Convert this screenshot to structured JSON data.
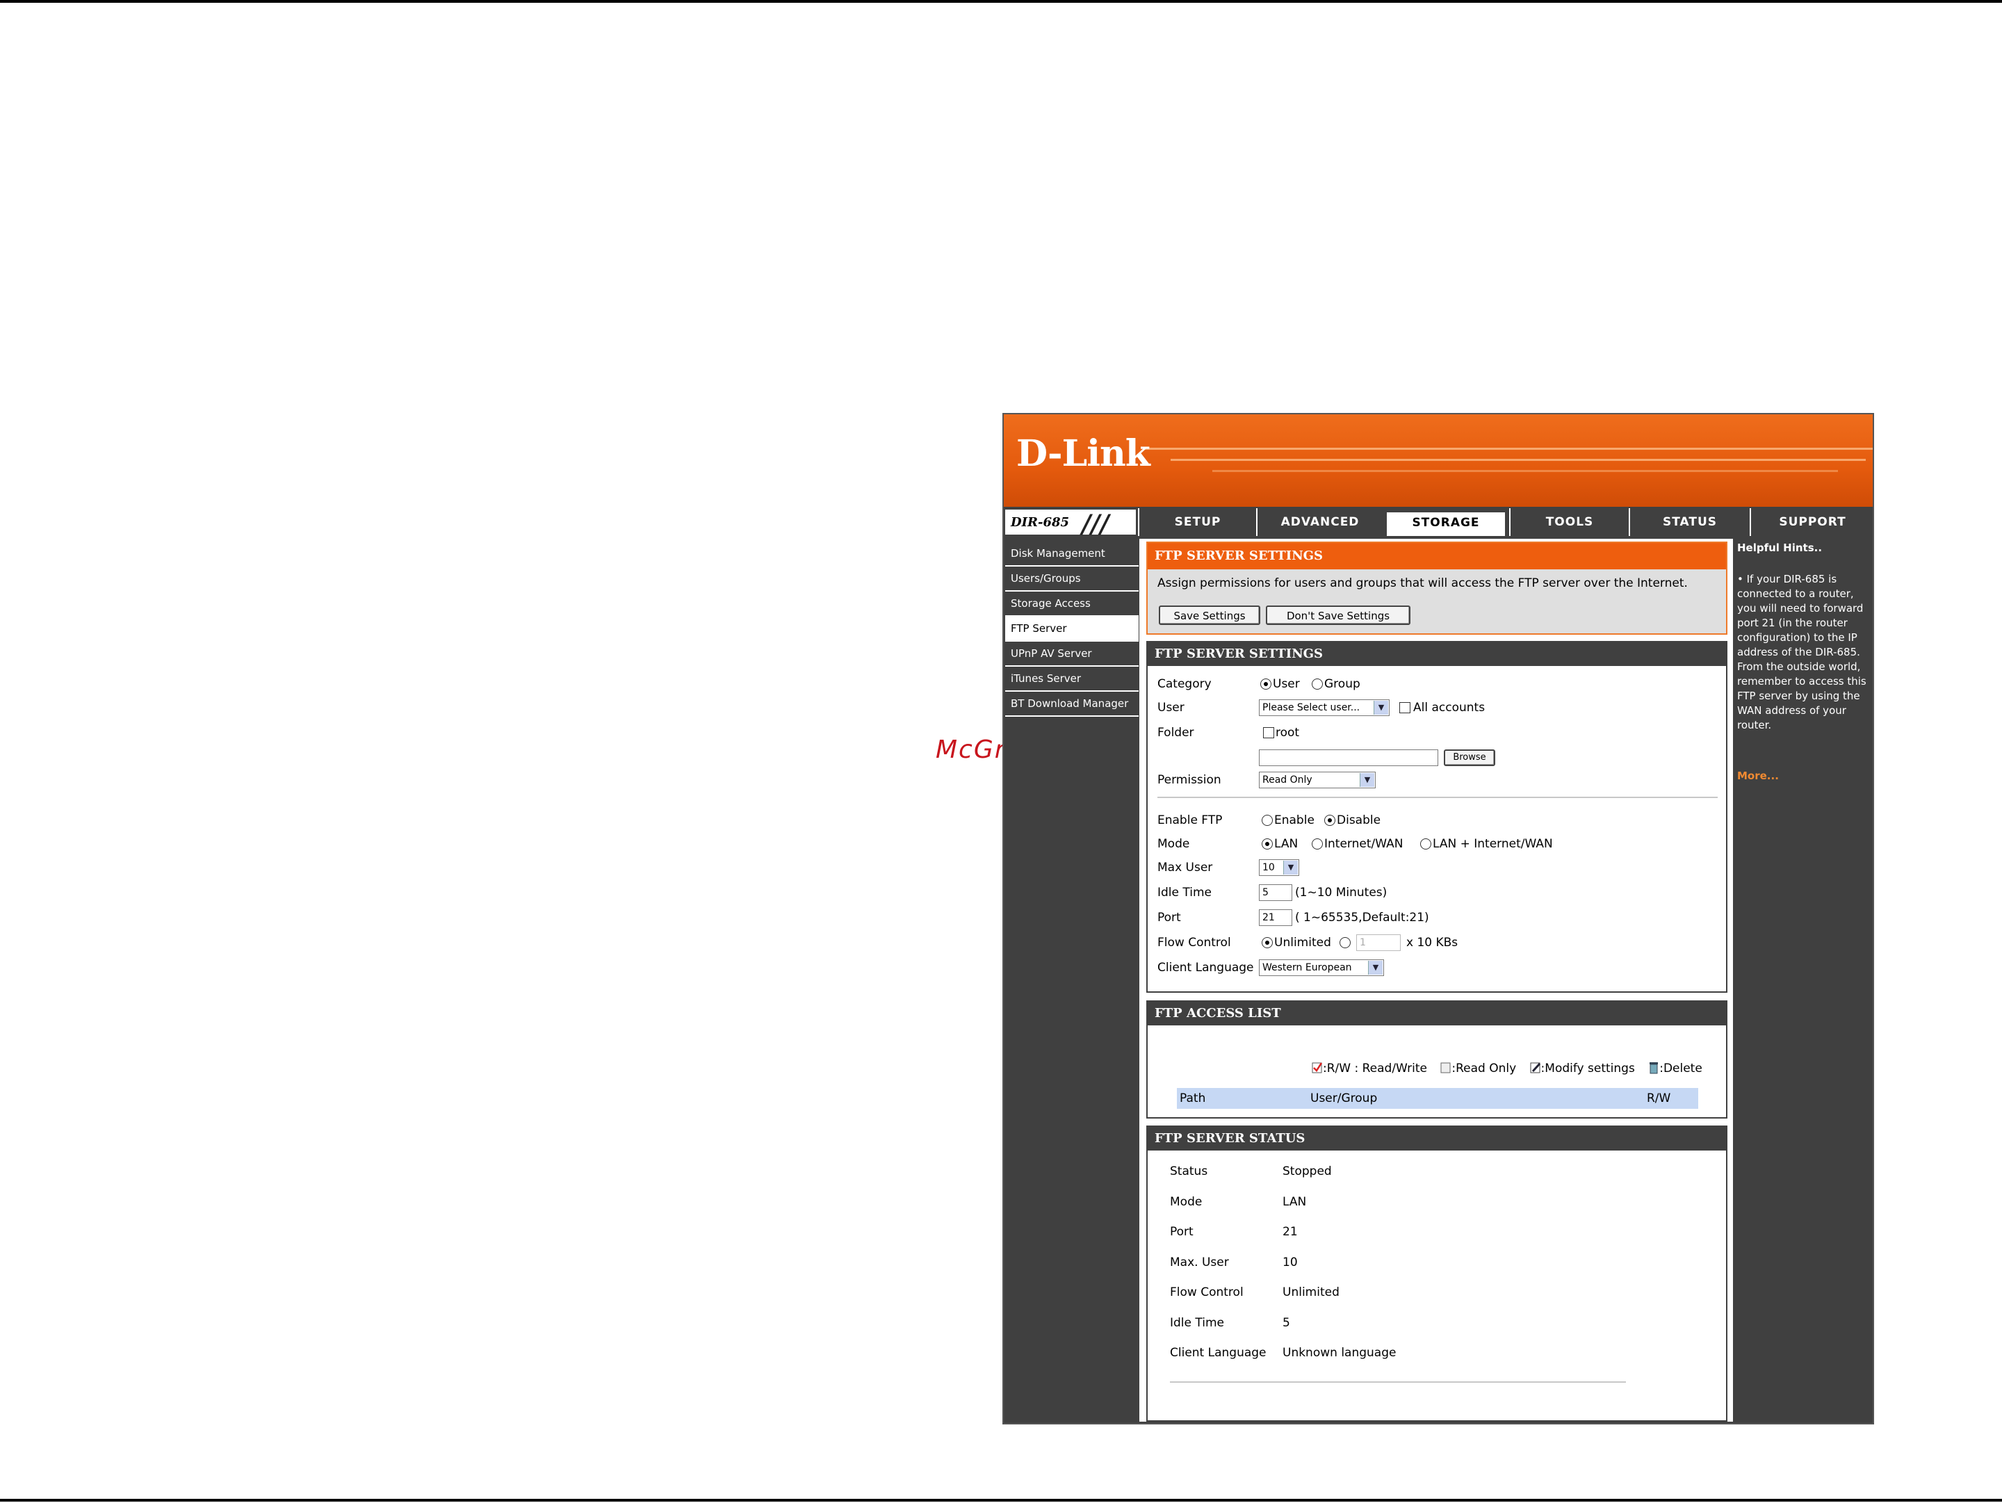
{
  "watermark": "McGrp.Ru",
  "router": {
    "brand": "D-Link",
    "model": "DIR-685",
    "tabs": [
      "SETUP",
      "ADVANCED",
      "STORAGE",
      "TOOLS",
      "STATUS",
      "SUPPORT"
    ],
    "active_tab": "STORAGE",
    "left_nav": [
      "Disk Management",
      "Users/Groups",
      "Storage Access",
      "FTP Server",
      "UPnP AV Server",
      "iTunes Server",
      "BT Download Manager"
    ],
    "active_left": "FTP Server",
    "intro": {
      "title": "FTP SERVER SETTINGS",
      "description": "Assign permissions for users and groups that will access the FTP server over the Internet.",
      "save_label": "Save Settings",
      "dont_save_label": "Don't Save Settings"
    },
    "settings": {
      "title": "FTP SERVER SETTINGS",
      "category_label": "Category",
      "category_options": [
        "User",
        "Group"
      ],
      "category_selected": "User",
      "user_label": "User",
      "user_select": "Please Select user...",
      "all_accounts_label": "All accounts",
      "folder_label": "Folder",
      "root_label": "root",
      "browse_label": "Browse",
      "permission_label": "Permission",
      "permission_select": "Read Only",
      "enable_ftp_label": "Enable FTP",
      "enable_options": [
        "Enable",
        "Disable"
      ],
      "enable_selected": "Disable",
      "mode_label": "Mode",
      "mode_options": [
        "LAN",
        "Internet/WAN",
        "LAN + Internet/WAN"
      ],
      "mode_selected": "LAN",
      "max_user_label": "Max User",
      "max_user_value": "10",
      "idle_label": "Idle Time",
      "idle_value": "5",
      "idle_hint": "(1~10 Minutes)",
      "port_label": "Port",
      "port_value": "21",
      "port_hint": "( 1~65535,Default:21)",
      "flow_label": "Flow Control",
      "flow_unlimited": "Unlimited",
      "flow_value": "1",
      "flow_unit": "x 10 KBs",
      "lang_label": "Client Language",
      "lang_select": "Western European"
    },
    "access": {
      "title": "FTP ACCESS LIST",
      "legend_rw": ":R/W : Read/Write",
      "legend_ro": ":Read Only",
      "legend_modify": ":Modify settings",
      "legend_delete": ":Delete",
      "col_path": "Path",
      "col_user": "User/Group",
      "col_rw": "R/W"
    },
    "status": {
      "title": "FTP SERVER STATUS",
      "rows": [
        {
          "label": "Status",
          "value": "Stopped"
        },
        {
          "label": "Mode",
          "value": "LAN"
        },
        {
          "label": "Port",
          "value": "21"
        },
        {
          "label": "Max. User",
          "value": "10"
        },
        {
          "label": "Flow Control",
          "value": "Unlimited"
        },
        {
          "label": "Idle Time",
          "value": "5"
        },
        {
          "label": "Client Language",
          "value": "Unknown language"
        }
      ]
    },
    "hints": {
      "title": "Helpful Hints..",
      "body": "• If your DIR-685 is connected to a router, you will need to forward port 21 (in the router configuration) to the IP address of the DIR-685. From the outside world, remember to access this FTP server by using the WAN address of your router.",
      "more": "More..."
    },
    "colors": {
      "accent_orange": "#ee5e0e",
      "dark_gray": "#404040",
      "table_header_blue": "#c6d8f4"
    }
  }
}
